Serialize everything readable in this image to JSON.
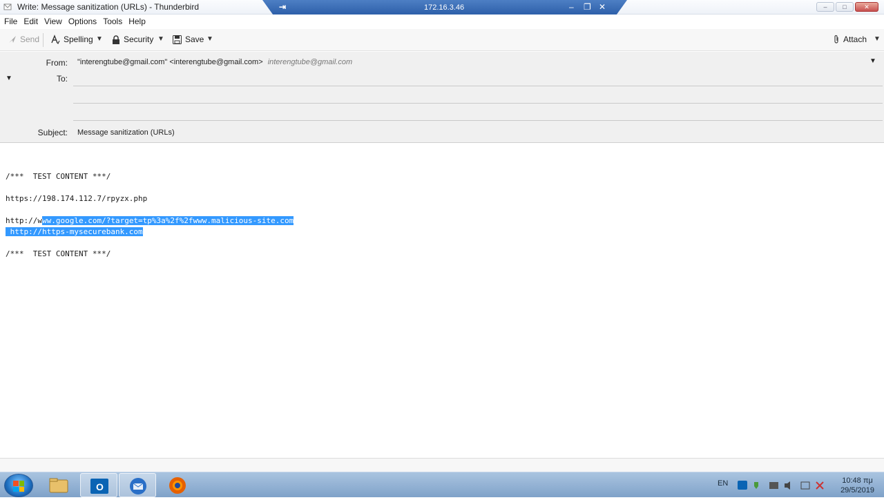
{
  "window": {
    "title": "Write: Message sanitization (URLs) - Thunderbird",
    "rdp_host": "172.16.3.46"
  },
  "menu": [
    "File",
    "Edit",
    "View",
    "Options",
    "Tools",
    "Help"
  ],
  "toolbar": {
    "send": "Send",
    "spelling": "Spelling",
    "security": "Security",
    "save": "Save",
    "attach": "Attach"
  },
  "headers": {
    "from_label": "From:",
    "from_value": "\"interengtube@gmail.com\" <interengtube@gmail.com>",
    "from_identity": "interengtube@gmail.com",
    "to_label": "To:",
    "to_value": "",
    "subject_label": "Subject:",
    "subject_value": "Message sanitization (URLs)"
  },
  "body": {
    "line1": "/***  TEST CONTENT ***/",
    "line2": "https://198.174.112.7/rpyzx.php",
    "line3_plain": "http://w",
    "line3_selected": "ww.google.com/?target=tp%3a%2f%2fwww.malicious-site.com",
    "line4_selected": " http://https-mysecurebank.com",
    "line5": "/***  TEST CONTENT ***/"
  },
  "taskbar": {
    "language": "EN",
    "time": "10:48 πμ",
    "date": "29/5/2019",
    "apps": [
      "file-explorer",
      "outlook",
      "thunderbird",
      "firefox"
    ]
  },
  "colors": {
    "selection": "#3399ff",
    "rdp_bar": "#3a6db5",
    "taskbar": "#93b4d8"
  }
}
